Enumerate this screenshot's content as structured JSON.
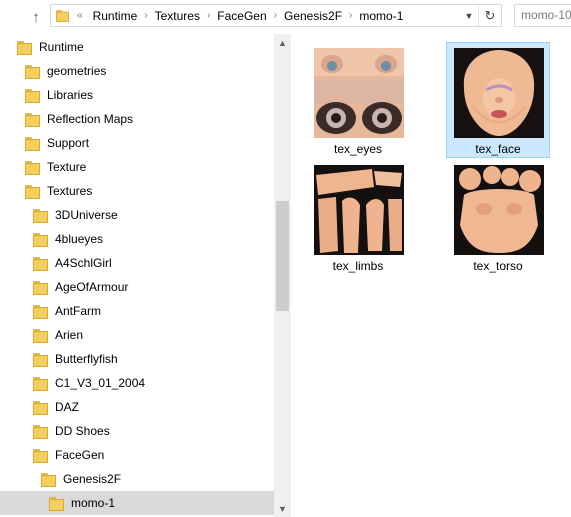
{
  "address_bar": {
    "overflow": "«",
    "path": [
      "Runtime",
      "Textures",
      "FaceGen",
      "Genesis2F",
      "momo-1"
    ],
    "search_placeholder": "momo-10"
  },
  "nav": {
    "items": [
      {
        "label": "Runtime",
        "level": 0
      },
      {
        "label": "geometries",
        "level": 1
      },
      {
        "label": "Libraries",
        "level": 1
      },
      {
        "label": "Reflection Maps",
        "level": 1
      },
      {
        "label": "Support",
        "level": 1
      },
      {
        "label": "Texture",
        "level": 1
      },
      {
        "label": "Textures",
        "level": 1
      },
      {
        "label": "3DUniverse",
        "level": 2
      },
      {
        "label": "4blueyes",
        "level": 2
      },
      {
        "label": "A4SchlGirl",
        "level": 2
      },
      {
        "label": "AgeOfArmour",
        "level": 2
      },
      {
        "label": "AntFarm",
        "level": 2
      },
      {
        "label": "Arien",
        "level": 2
      },
      {
        "label": "Butterflyfish",
        "level": 2
      },
      {
        "label": "C1_V3_01_2004",
        "level": 2
      },
      {
        "label": "DAZ",
        "level": 2
      },
      {
        "label": "DD Shoes",
        "level": 2
      },
      {
        "label": "FaceGen",
        "level": 2
      },
      {
        "label": "Genesis2F",
        "level": 3
      },
      {
        "label": "momo-1",
        "level": 4,
        "selected": true
      }
    ]
  },
  "files": [
    {
      "name": "tex_eyes",
      "icon": "eyes-texture-thumbnail"
    },
    {
      "name": "tex_face",
      "icon": "face-texture-thumbnail",
      "selected": true
    },
    {
      "name": "tex_limbs",
      "icon": "limbs-texture-thumbnail"
    },
    {
      "name": "tex_torso",
      "icon": "torso-texture-thumbnail"
    }
  ],
  "colors": {
    "selection": "#cce8ff",
    "nav_selection": "#d9d9d9",
    "folder": "#f5cf5b"
  }
}
